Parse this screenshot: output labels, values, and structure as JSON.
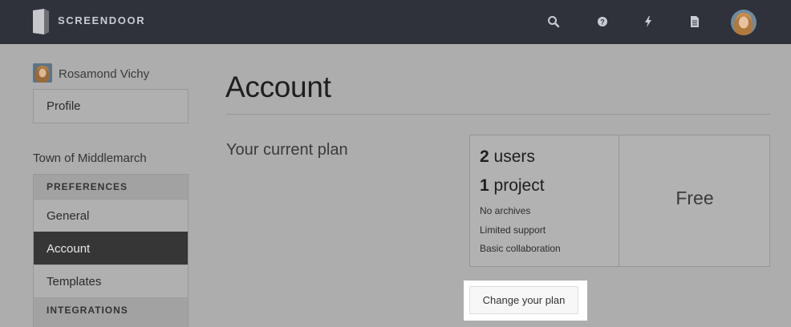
{
  "app": {
    "brand": "SCREENDOOR"
  },
  "topnav": {
    "icons": [
      "search-icon",
      "help-icon",
      "lightning-icon",
      "document-icon"
    ],
    "avatar": "user-avatar"
  },
  "sidebar": {
    "user_name": "Rosamond Vichy",
    "user_items": [
      {
        "label": "Profile"
      }
    ],
    "org_name": "Town of Middlemarch",
    "preferences_heading": "PREFERENCES",
    "preferences_items": [
      {
        "label": "General",
        "active": false
      },
      {
        "label": "Account",
        "active": true
      },
      {
        "label": "Templates",
        "active": false
      }
    ],
    "integrations_heading": "INTEGRATIONS"
  },
  "main": {
    "title": "Account",
    "section_label": "Your current plan",
    "plan": {
      "users_count": "2",
      "users_label": "users",
      "projects_count": "1",
      "projects_label": "project",
      "features": [
        "No archives",
        "Limited support",
        "Basic collaboration"
      ],
      "name": "Free"
    },
    "change_plan_label": "Change your plan"
  },
  "colors": {
    "topbar": "#2f323a",
    "overlay": "#adadad",
    "active_item": "#363636",
    "spotlight": "#ffffff"
  }
}
